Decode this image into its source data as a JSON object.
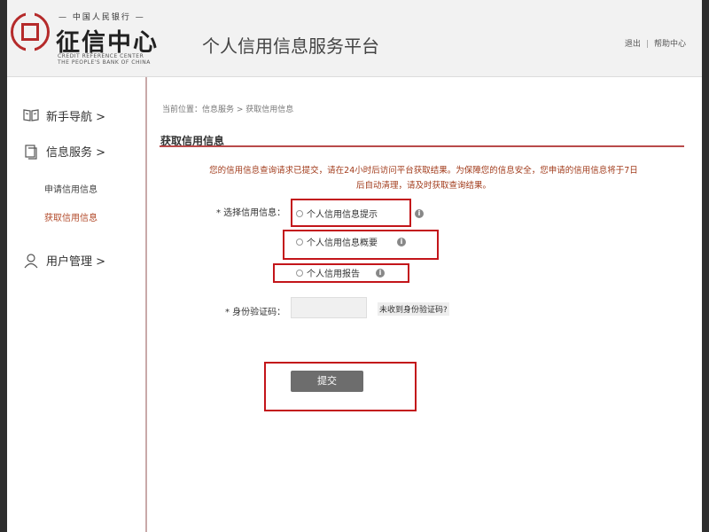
{
  "header": {
    "logo_top": "— 中国人民银行 —",
    "logo_name": "征信中心",
    "logo_en_line1": "CREDIT REFERENCE CENTER",
    "logo_en_line2": "THE PEOPLE'S BANK OF CHINA",
    "platform_title": "个人信用信息服务平台",
    "logout": "退出",
    "separator": "|",
    "help": "帮助中心"
  },
  "sidebar": {
    "items": [
      {
        "label": "新手导航 >",
        "icon": "book-icon"
      },
      {
        "label": "信息服务 >",
        "icon": "document-icon"
      },
      {
        "label": "用户管理 >",
        "icon": "user-icon"
      }
    ],
    "subitems": [
      {
        "label": "申请信用信息",
        "active": false
      },
      {
        "label": "获取信用信息",
        "active": true
      }
    ]
  },
  "main": {
    "breadcrumb": "当前位置：信息服务 > 获取信用信息",
    "section_title": "获取信用信息",
    "notice_line1": "您的信用信息查询请求已提交，请在24小时后访问平台获取结果。为保障您的信息安全，您申请的信用信息将于7日",
    "notice_line2": "后自动清理，请及时获取查询结果。",
    "select_label": "* 选择信用信息：",
    "options": [
      {
        "label": "个人信用信息提示"
      },
      {
        "label": "个人信用信息概要"
      },
      {
        "label": "个人信用报告"
      }
    ],
    "code_label": "* 身份验证码：",
    "code_value": "",
    "code_link": "未收到身份验证码?",
    "submit": "提交"
  },
  "colors": {
    "accent_red": "#b94a4a",
    "highlight_red": "#c3151a",
    "notice_text": "#a23c1c",
    "button_gray": "#6d6d6d"
  }
}
